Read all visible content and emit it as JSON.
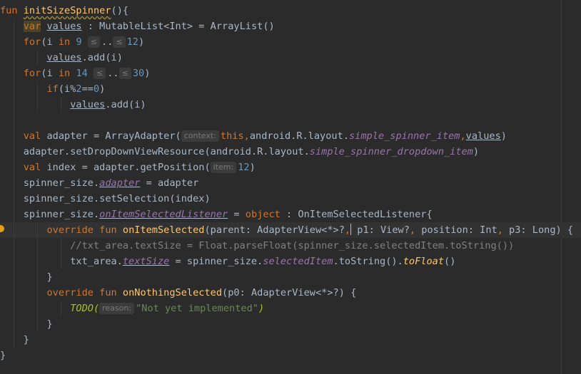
{
  "editor": {
    "lines": [
      [
        {
          "t": "fun ",
          "c": "kw"
        },
        {
          "t": "initSizeSpinner",
          "c": "fn uy"
        },
        {
          "t": "(){"
        }
      ],
      [
        {
          "t": "    "
        },
        {
          "t": "var",
          "c": "kw var-hl"
        },
        {
          "t": " "
        },
        {
          "t": "values",
          "c": "u"
        },
        {
          "t": " : MutableList<Int> = ArrayList()"
        }
      ],
      [
        {
          "t": "    "
        },
        {
          "t": "for",
          "c": "kw"
        },
        {
          "t": "(i "
        },
        {
          "t": "in",
          "c": "kw"
        },
        {
          "t": " "
        },
        {
          "t": "9",
          "c": "num"
        },
        {
          "t": " "
        },
        {
          "h": "≤"
        },
        {
          "t": ".."
        },
        {
          "h": "≤"
        },
        {
          "t": "12",
          "c": "num"
        },
        {
          "t": ")"
        }
      ],
      [
        {
          "t": "        "
        },
        {
          "t": "values",
          "c": "u"
        },
        {
          "t": ".add(i)"
        }
      ],
      [
        {
          "t": "    "
        },
        {
          "t": "for",
          "c": "kw"
        },
        {
          "t": "(i "
        },
        {
          "t": "in",
          "c": "kw"
        },
        {
          "t": " "
        },
        {
          "t": "14",
          "c": "num"
        },
        {
          "t": " "
        },
        {
          "h": "≤"
        },
        {
          "t": ".."
        },
        {
          "h": "≤"
        },
        {
          "t": "30",
          "c": "num"
        },
        {
          "t": ")"
        }
      ],
      [
        {
          "t": "        "
        },
        {
          "t": "if",
          "c": "kw"
        },
        {
          "t": "(i%"
        },
        {
          "t": "2",
          "c": "num"
        },
        {
          "t": "=="
        },
        {
          "t": "0",
          "c": "num"
        },
        {
          "t": ")"
        }
      ],
      [
        {
          "t": "            "
        },
        {
          "t": "values",
          "c": "u"
        },
        {
          "t": ".add(i)"
        }
      ],
      [],
      [
        {
          "t": "    "
        },
        {
          "t": "val",
          "c": "kw"
        },
        {
          "t": " adapter = ArrayAdapter("
        },
        {
          "h": "context:"
        },
        {
          "t": "this",
          "c": "kw"
        },
        {
          "t": ",",
          "c": "kw"
        },
        {
          "t": "android.R.layout."
        },
        {
          "t": "simple_spinner_item",
          "c": "prop it"
        },
        {
          "t": ",",
          "c": "kw"
        },
        {
          "t": "values",
          "c": "u"
        },
        {
          "t": ")"
        }
      ],
      [
        {
          "t": "    adapter.setDropDownViewResource(android.R.layout."
        },
        {
          "t": "simple_spinner_dropdown_item",
          "c": "prop it"
        },
        {
          "t": ")"
        }
      ],
      [
        {
          "t": "    "
        },
        {
          "t": "val",
          "c": "kw"
        },
        {
          "t": " index = adapter.getPosition("
        },
        {
          "h": "item:"
        },
        {
          "t": "12",
          "c": "num"
        },
        {
          "t": ")"
        }
      ],
      [
        {
          "t": "    spinner_size."
        },
        {
          "t": "adapter",
          "c": "prop it u"
        },
        {
          "t": " = adapter"
        }
      ],
      [
        {
          "t": "    spinner_size.setSelection(index)"
        }
      ],
      [
        {
          "t": "    spinner_size."
        },
        {
          "t": "onItemSelectedListener",
          "c": "prop it u"
        },
        {
          "t": " = "
        },
        {
          "t": "object",
          "c": "kw"
        },
        {
          "t": " : OnItemSelectedListener{"
        }
      ],
      [
        {
          "t": "        "
        },
        {
          "t": "override fun",
          "c": "kw"
        },
        {
          "t": " "
        },
        {
          "t": "onItemSelected",
          "c": "fn"
        },
        {
          "t": "(parent: AdapterView<*>?"
        },
        {
          "t": ",",
          "c": "kw"
        },
        {
          "caret": true
        },
        {
          "t": " p1: View?"
        },
        {
          "t": ",",
          "c": "kw"
        },
        {
          "t": " position: Int"
        },
        {
          "t": ",",
          "c": "kw"
        },
        {
          "t": " p3: Long) {"
        }
      ],
      [
        {
          "t": "            "
        },
        {
          "t": "//txt_area.textSize = Float.parseFloat(spinner_size.selectedItem.toString())",
          "c": "cmt"
        }
      ],
      [
        {
          "t": "            txt_area."
        },
        {
          "t": "textSize",
          "c": "prop it u"
        },
        {
          "t": " = spinner_size."
        },
        {
          "t": "selectedItem",
          "c": "prop it"
        },
        {
          "t": ".toString()."
        },
        {
          "t": "toFloat",
          "c": "fn it"
        },
        {
          "t": "()"
        }
      ],
      [
        {
          "t": "        }"
        }
      ],
      [
        {
          "t": "        "
        },
        {
          "t": "override fun",
          "c": "kw"
        },
        {
          "t": " "
        },
        {
          "t": "onNothingSelected",
          "c": "fn"
        },
        {
          "t": "(p0: AdapterView<*>?) {"
        }
      ],
      [
        {
          "t": "            "
        },
        {
          "t": "TODO(",
          "c": "todo"
        },
        {
          "h": "reason:"
        },
        {
          "t": "\"Not yet implemented\"",
          "c": "str"
        },
        {
          "t": ")",
          "c": "todo"
        }
      ],
      [
        {
          "t": "        }"
        }
      ],
      [
        {
          "t": "    }"
        }
      ],
      [
        {
          "t": "}"
        }
      ]
    ]
  }
}
